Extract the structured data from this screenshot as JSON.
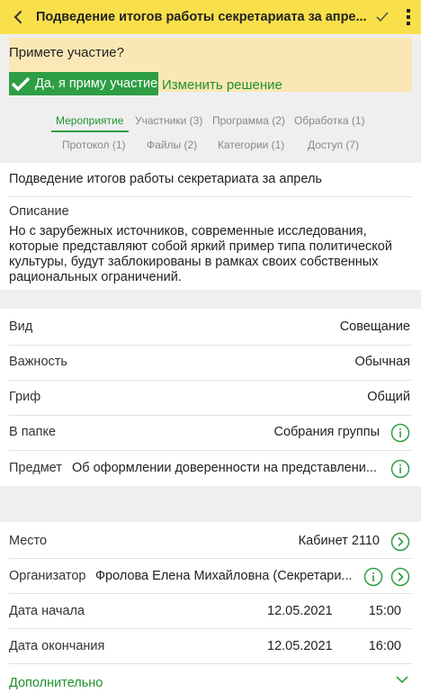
{
  "header": {
    "title": "Подведение итогов работы секретариата за апре...",
    "icons": [
      "arrow-left-icon",
      "checkmark-icon",
      "more-vertical-icon"
    ],
    "background_color": "#f9e04b"
  },
  "participation": {
    "question": "Примете участие?",
    "accept_label": "Да, я приму участие",
    "change_label": "Изменить решение",
    "panel_color": "#fbe7b6",
    "accept_color": "#2e9e44"
  },
  "tabs": [
    {
      "label": "Мероприятие",
      "active": true
    },
    {
      "label": "Участники (3)",
      "active": false
    },
    {
      "label": "Программа (2)",
      "active": false
    },
    {
      "label": "Обработка (1)",
      "active": false
    },
    {
      "label": "Протокол (1)",
      "active": false
    },
    {
      "label": "Файлы (2)",
      "active": false
    },
    {
      "label": "Категории (1)",
      "active": false
    },
    {
      "label": "Доступ (7)",
      "active": false
    }
  ],
  "event": {
    "title": "Подведение итогов работы секретариата за апрель",
    "description_label": "Описание",
    "description": "Но с зарубежных источников, современные исследования, которые представляют собой яркий пример типа политической культуры, будут заблокированы в рамках своих собственных рациональных ограничений."
  },
  "properties": [
    {
      "label": "Вид",
      "value": "Совещание"
    },
    {
      "label": "Важность",
      "value": "Обычная"
    },
    {
      "label": "Гриф",
      "value": "Общий"
    },
    {
      "label": "В папке",
      "value": "Собрания группы"
    },
    {
      "label": "Предмет",
      "value": "Об оформлении доверенности на представлени..."
    }
  ],
  "details": {
    "place_label": "Место",
    "place_value": "Кабинет 2110",
    "organizer_label": "Организатор",
    "organizer_value": "Фролова Елена Михайловна (Секретари...",
    "start_label": "Дата начала",
    "start_date": "12.05.2021",
    "start_time": "15:00",
    "end_label": "Дата окончания",
    "end_date": "12.05.2021",
    "end_time": "16:00"
  },
  "more": {
    "label": "Дополнительно"
  },
  "accent_color": "#2e9e44"
}
